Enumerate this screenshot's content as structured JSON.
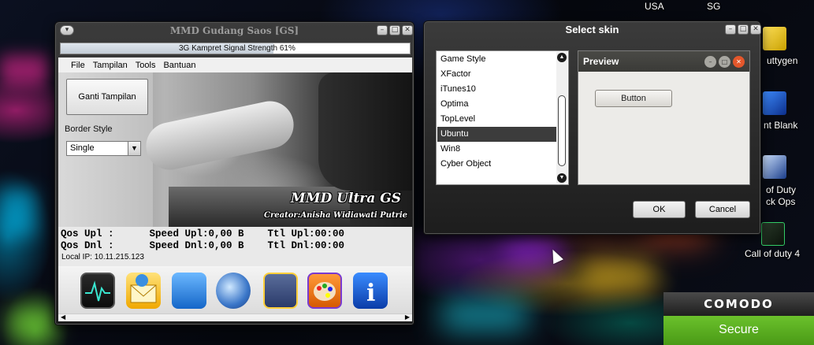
{
  "desktop": {
    "labels": {
      "usa": "USA",
      "sg": "SG",
      "puttygen": "uttygen",
      "point_blank": "nt Blank",
      "of_duty": "of Duty",
      "ck_ops": "ck Ops",
      "call_of_duty_4": "Call of duty 4"
    }
  },
  "mmd": {
    "title": "MMD Gudang Saos [GS]",
    "signal_text": "3G Kampret Signal Strength 61%",
    "signal_percent": 61,
    "menu": [
      "File",
      "Tampilan",
      "Tools",
      "Bantuan"
    ],
    "ganti_label": "Ganti Tampilan",
    "border_style_label": "Border Style",
    "border_style_value": "Single",
    "brand_title": "MMD Ultra GS",
    "brand_creator": "Creator:Anisha Widiawati Putrie",
    "stats": {
      "row1": "Qos Upl :      Speed Upl:0,00 B    Ttl Upl:00:00",
      "row2": "Qos Dnl :      Speed Dnl:0,00 B    Ttl Dnl:00:00",
      "local_ip": "Local IP: 10.11.215.123"
    },
    "dock_icons": [
      "monitor-icon",
      "sms-icon",
      "notepad-icon",
      "network-globe-icon",
      "calculator-icon",
      "palette-icon",
      "info-icon"
    ]
  },
  "skin": {
    "title": "Select skin",
    "items": [
      "Game Style",
      "XFactor",
      "iTunes10",
      "Optima",
      "TopLevel",
      "Ubuntu",
      "Win8",
      "Cyber Object"
    ],
    "selected": "Ubuntu",
    "preview_title": "Preview",
    "preview_button": "Button",
    "ok_label": "OK",
    "cancel_label": "Cancel"
  },
  "comodo": {
    "brand": "COMODO",
    "status": "Secure",
    "status_color": "#5bb021"
  }
}
